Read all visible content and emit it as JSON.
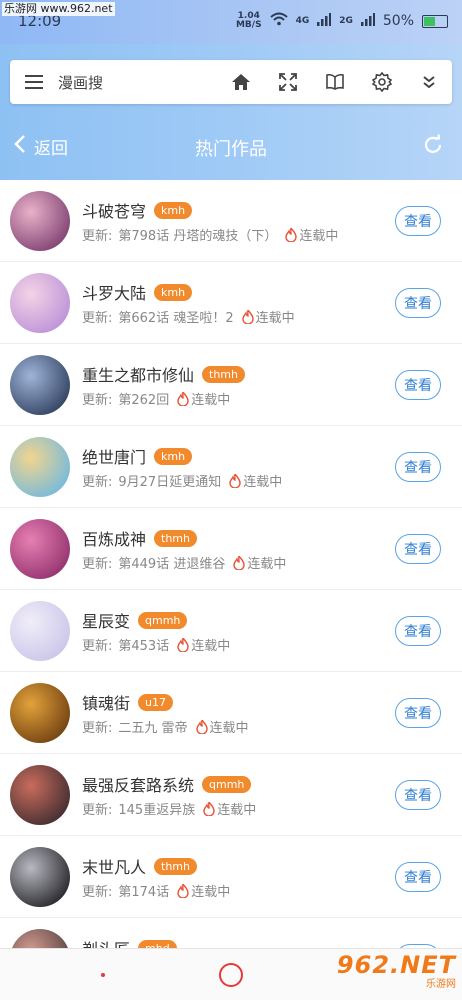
{
  "watermark": {
    "site": "乐游网 www.962.net",
    "logo": "962.NET",
    "logo_sub": "乐游网"
  },
  "status": {
    "time": "12:09",
    "speed_top": "1.04",
    "speed_unit": "MB/S",
    "sig1": "4G",
    "sig2": "2G",
    "battery": "50%"
  },
  "search": {
    "placeholder": "漫画搜"
  },
  "nav": {
    "back_label": "返回",
    "title": "热门作品"
  },
  "list": {
    "update_prefix": "更新:",
    "status_label": "连载中",
    "view_label": "查看",
    "items": [
      {
        "title": "斗破苍穹",
        "tag": "kmh",
        "update": "第798话 丹塔的魂技（下）",
        "colors": [
          "#7a3b6e",
          "#e9b2c9"
        ]
      },
      {
        "title": "斗罗大陆",
        "tag": "kmh",
        "update": "第662话 魂圣啦！2",
        "colors": [
          "#b98fd8",
          "#f4d3e5"
        ]
      },
      {
        "title": "重生之都市修仙",
        "tag": "thmh",
        "update": "第262回",
        "colors": [
          "#2c3c5a",
          "#9fb4d9"
        ]
      },
      {
        "title": "绝世唐门",
        "tag": "kmh",
        "update": "9月27日延更通知",
        "colors": [
          "#6fb8e0",
          "#f1d58f"
        ]
      },
      {
        "title": "百炼成神",
        "tag": "thmh",
        "update": "第449话 进退维谷",
        "colors": [
          "#8e2f6c",
          "#e77fb2"
        ]
      },
      {
        "title": "星辰变",
        "tag": "qmmh",
        "update": "第453话",
        "colors": [
          "#c9c3e8",
          "#f1eef9"
        ]
      },
      {
        "title": "镇魂街",
        "tag": "u17",
        "update": "二五九 雷帝",
        "colors": [
          "#6b3c10",
          "#e2a23a"
        ]
      },
      {
        "title": "最强反套路系统",
        "tag": "qmmh",
        "update": "145重返异族",
        "colors": [
          "#3a2a2e",
          "#c96c5c"
        ]
      },
      {
        "title": "末世凡人",
        "tag": "thmh",
        "update": "第174话",
        "colors": [
          "#1e1e22",
          "#b9b9c2"
        ]
      },
      {
        "title": "剃头匠",
        "tag": "mhd",
        "update": "",
        "colors": [
          "#4a3b3b",
          "#d29a8f"
        ]
      }
    ]
  },
  "colors": {
    "accent": "#f08a2c",
    "button_blue": "#2f7fd3",
    "header": "#9fcaf6"
  }
}
